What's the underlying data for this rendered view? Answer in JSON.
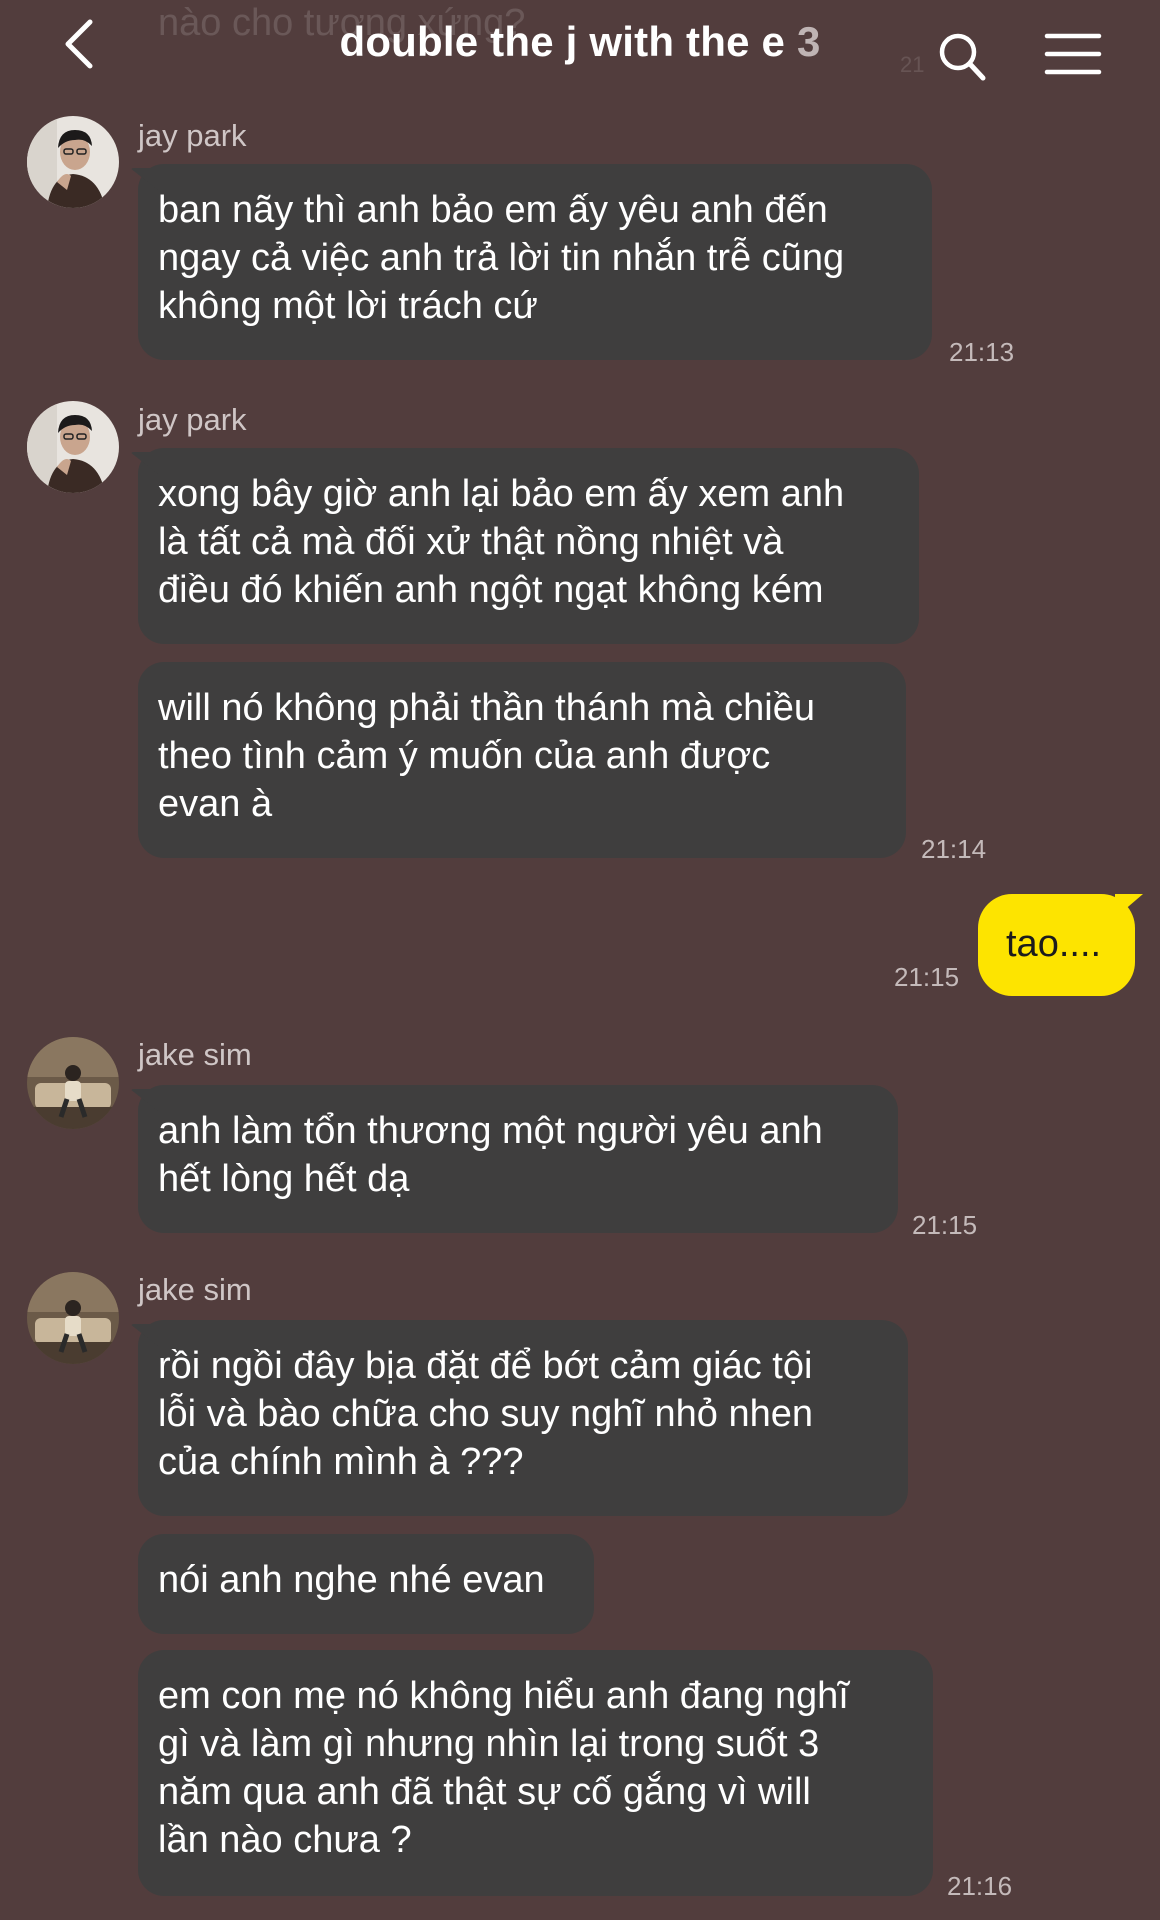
{
  "header": {
    "ghost_text": "nào cho tương xứng?",
    "ghost_time": "21",
    "title": "double the j with the e",
    "member_count": "3",
    "back_icon": "chevron-left-icon",
    "search_icon": "search-icon",
    "menu_icon": "hamburger-menu-icon"
  },
  "colors": {
    "background": "#523d3d",
    "bubble_other": "#3f3e3e",
    "bubble_self": "#fde400"
  },
  "messages": [
    {
      "sender": "jay park",
      "bubbles": [
        "ban nãy thì anh bảo em ấy yêu anh đến\nngay cả việc anh trả lời tin nhắn trễ cũng\nkhông một lời trách cứ"
      ],
      "time": "21:13"
    },
    {
      "sender": "jay park",
      "bubbles": [
        "xong bây giờ anh lại bảo em ấy xem anh\nlà tất cả mà đối xử thật nồng nhiệt và\nđiều đó khiến anh ngột ngạt không kém",
        "will nó không phải thần thánh mà chiều\ntheo tình cảm ý muốn của anh được\nevan à"
      ],
      "time": "21:14"
    },
    {
      "sender": "me",
      "bubbles": [
        "tao...."
      ],
      "time": "21:15"
    },
    {
      "sender": "jake sim",
      "bubbles": [
        "anh làm tổn thương một người yêu anh\nhết lòng hết dạ"
      ],
      "time": "21:15"
    },
    {
      "sender": "jake sim",
      "bubbles": [
        "rồi ngồi đây bịa đặt để bớt cảm giác tội\nlỗi và bào chữa cho suy nghĩ nhỏ nhen\ncủa chính mình à ???",
        "nói anh nghe nhé evan",
        "em con mẹ nó không hiểu anh đang nghĩ\ngì và làm gì nhưng nhìn lại trong suốt 3\nnăm qua anh đã thật sự cố gắng vì will\nlần nào chưa ?"
      ],
      "time": "21:16"
    }
  ]
}
